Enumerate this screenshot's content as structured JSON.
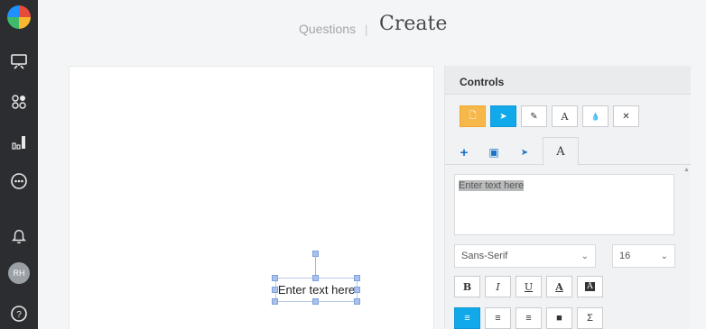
{
  "header": {
    "crumb": "Questions",
    "separator": "|",
    "title": "Create"
  },
  "rail": {
    "icons": [
      "logo-icon",
      "presentation-icon",
      "group-icon",
      "bar-chart-icon",
      "more-icon",
      "bell-icon",
      "help-icon"
    ],
    "avatar_initials": "RH"
  },
  "canvas": {
    "text_box": "Enter text here"
  },
  "controls": {
    "title": "Controls",
    "tools": [
      {
        "name": "page-icon",
        "glyph": "🗋"
      },
      {
        "name": "pointer-icon",
        "glyph": "➤"
      },
      {
        "name": "pencil-icon",
        "glyph": "✎"
      },
      {
        "name": "text-icon",
        "glyph": "A"
      },
      {
        "name": "drop-icon",
        "glyph": "💧"
      },
      {
        "name": "close-icon",
        "glyph": "✕"
      }
    ],
    "subtabs": [
      {
        "name": "plus-icon",
        "glyph": "+"
      },
      {
        "name": "image-icon",
        "glyph": "▣"
      },
      {
        "name": "pointer-icon",
        "glyph": "➤"
      },
      {
        "name": "text-tab",
        "glyph": "A"
      }
    ],
    "textarea_value": "Enter text here",
    "font_select": "Sans-Serif",
    "size_select": "16",
    "format_buttons": [
      "B",
      "I",
      "U",
      "A",
      "A"
    ],
    "align_buttons": [
      "≡",
      "≡",
      "≡",
      "■",
      "Σ"
    ],
    "colors": {
      "accent_blue": "#12a9ea",
      "accent_yellow": "#f7b84b"
    }
  }
}
